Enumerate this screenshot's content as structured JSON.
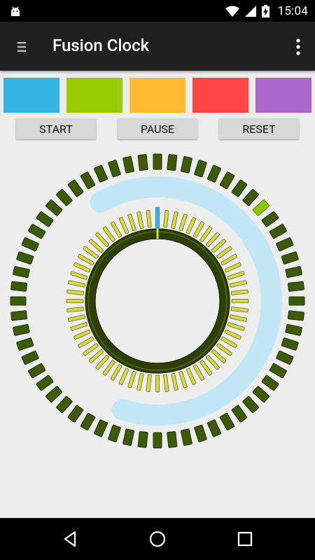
{
  "status_bar": {
    "time": "15:04",
    "icons": [
      "android-debug-icon",
      "wifi-icon",
      "signal-icon",
      "battery-charging-icon"
    ]
  },
  "app_bar": {
    "title": "Fusion Clock",
    "icons": [
      "drawer-menu-icon",
      "overflow-menu-icon"
    ]
  },
  "color_swatches": [
    {
      "name": "blue",
      "color": "#33b5e5"
    },
    {
      "name": "green",
      "color": "#99cc00"
    },
    {
      "name": "orange",
      "color": "#ffbb33"
    },
    {
      "name": "red",
      "color": "#ff4444"
    },
    {
      "name": "purple",
      "color": "#aa66cc"
    }
  ],
  "controls": {
    "start_label": "START",
    "pause_label": "PAUSE",
    "reset_label": "RESET"
  },
  "clock": {
    "outer_ticks": 60,
    "outer_highlight_index": 8,
    "inner_ticks": 60,
    "inner_highlight_index": 0,
    "progress_arc_minutes": 38,
    "colors": {
      "outer_tick": "#3d5a0a",
      "outer_tick_highlight": "#8fc400",
      "inner_tick": "#d6d94a",
      "inner_tick_highlight": "#33b5e5",
      "progress_arc": "#bfe6f7",
      "ring": "#2e3f06"
    }
  },
  "nav_bar": {
    "icons": [
      "back-icon",
      "home-icon",
      "recents-icon"
    ]
  }
}
